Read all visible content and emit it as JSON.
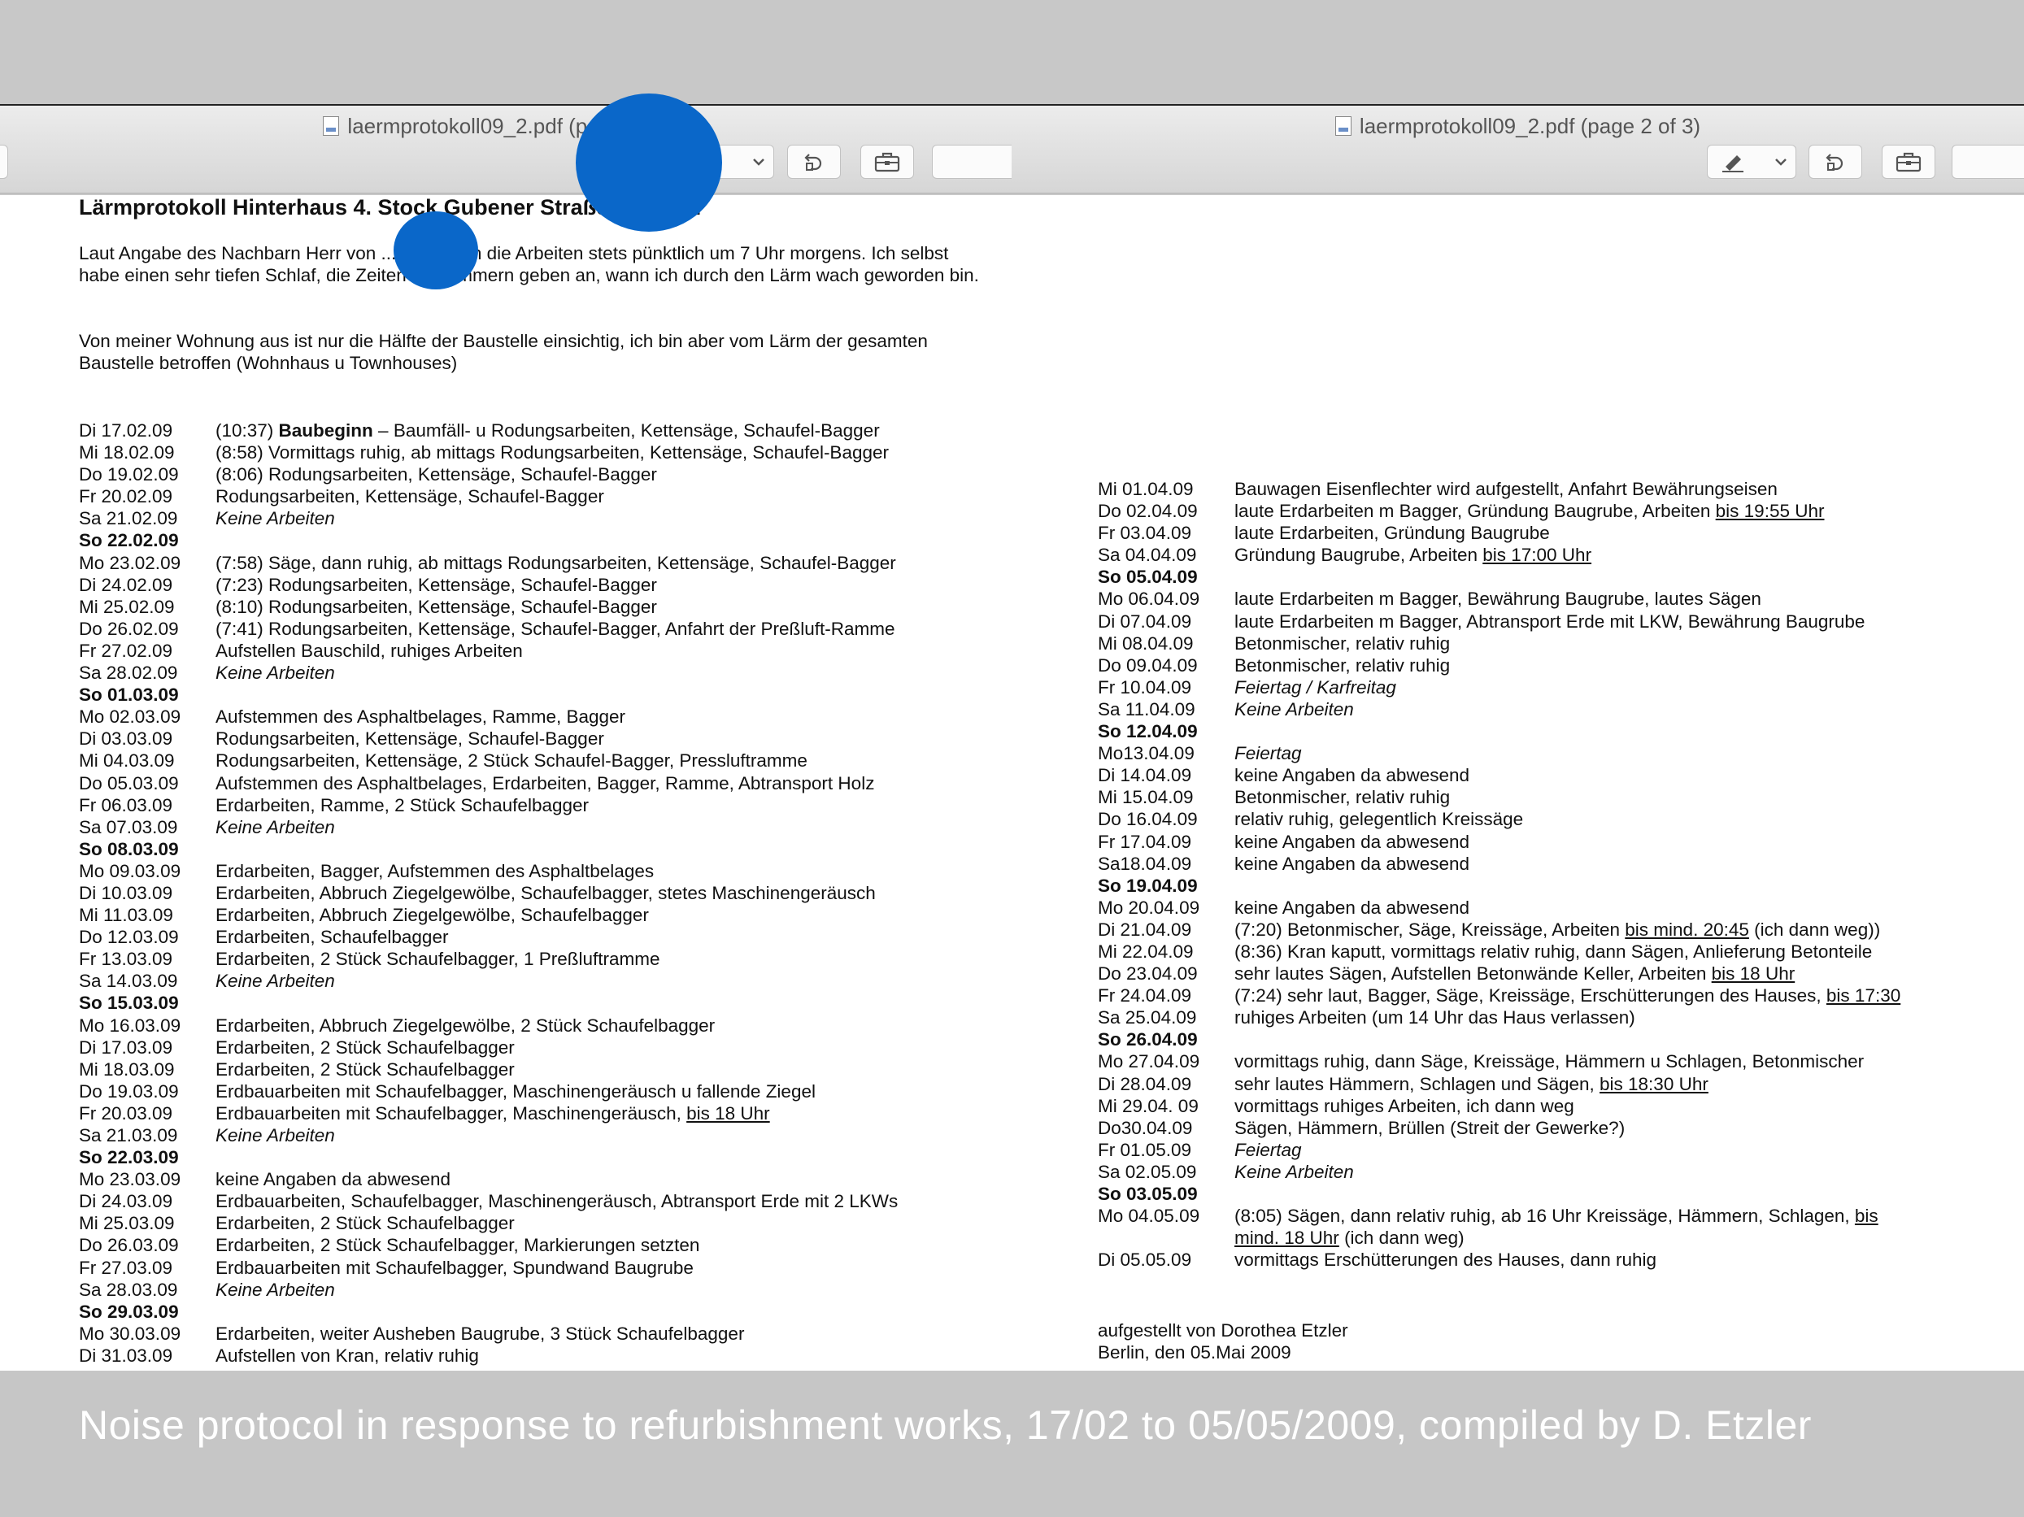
{
  "left_window": {
    "title": "laermprotokoll09_2.pdf (page 1 of 3)"
  },
  "right_window": {
    "title": "laermprotokoll09_2.pdf (page 2 of 3)"
  },
  "toolbar_icons": [
    "annotate-pen-icon",
    "chevron-down-icon",
    "rotate-left-icon",
    "toolbox-icon"
  ],
  "page1": {
    "title": "Lärmprotokoll Hinterhaus 4. Stock Gubener Straße ... Berlin",
    "para1": "Laut Angabe des Nachbarn Herr von ..., beginnen die Arbeiten stets pünktlich um 7 Uhr morgens. Ich selbst habe einen sehr tiefen Schlaf, die Zeiten in Klammern geben an, wann ich durch den Lärm wach geworden bin.",
    "para2": "Von meiner Wohnung aus ist nur die Hälfte der Baustelle einsichtig, ich bin aber vom Lärm der gesamten Baustelle betroffen (Wohnhaus u Townhouses)",
    "entries": [
      {
        "date": "Di 17.02.09",
        "pre": "(10:37) ",
        "bold": "Baubeginn",
        "text": " – Baumfäll- u Rodungsarbeiten, Kettensäge, Schaufel-Bagger"
      },
      {
        "date": "Mi 18.02.09",
        "text": "(8:58) Vormittags ruhig, ab mittags Rodungsarbeiten, Kettensäge, Schaufel-Bagger"
      },
      {
        "date": "Do 19.02.09",
        "text": "(8:06) Rodungsarbeiten, Kettensäge, Schaufel-Bagger"
      },
      {
        "date": "Fr 20.02.09",
        "text": "Rodungsarbeiten, Kettensäge, Schaufel-Bagger"
      },
      {
        "date": "Sa 21.02.09",
        "text": "Keine Arbeiten",
        "italic": true
      },
      {
        "date": "So 22.02.09",
        "sunday": true
      },
      {
        "date": "Mo 23.02.09",
        "text": "(7:58) Säge, dann ruhig, ab mittags Rodungsarbeiten, Kettensäge, Schaufel-Bagger"
      },
      {
        "date": "Di 24.02.09",
        "text": "(7:23) Rodungsarbeiten, Kettensäge, Schaufel-Bagger"
      },
      {
        "date": "Mi 25.02.09",
        "text": "(8:10) Rodungsarbeiten, Kettensäge, Schaufel-Bagger"
      },
      {
        "date": "Do 26.02.09",
        "text": "(7:41) Rodungsarbeiten, Kettensäge, Schaufel-Bagger, Anfahrt der Preßluft-Ramme"
      },
      {
        "date": "Fr 27.02.09",
        "text": "Aufstellen Bauschild, ruhiges Arbeiten"
      },
      {
        "date": "Sa 28.02.09",
        "text": "Keine Arbeiten",
        "italic": true
      },
      {
        "date": "So 01.03.09",
        "sunday": true
      },
      {
        "date": "Mo 02.03.09",
        "text": "Aufstemmen des Asphaltbelages, Ramme, Bagger"
      },
      {
        "date": "Di 03.03.09",
        "text": "Rodungsarbeiten, Kettensäge, Schaufel-Bagger"
      },
      {
        "date": "Mi 04.03.09",
        "text": "Rodungsarbeiten, Kettensäge, 2 Stück Schaufel-Bagger, Pressluftramme"
      },
      {
        "date": "Do 05.03.09",
        "text": "Aufstemmen des Asphaltbelages, Erdarbeiten, Bagger, Ramme, Abtransport Holz"
      },
      {
        "date": "Fr 06.03.09",
        "text": "Erdarbeiten, Ramme, 2 Stück Schaufelbagger"
      },
      {
        "date": "Sa 07.03.09",
        "text": "Keine Arbeiten",
        "italic": true
      },
      {
        "date": "So 08.03.09",
        "sunday": true
      },
      {
        "date": "Mo 09.03.09",
        "text": "Erdarbeiten, Bagger, Aufstemmen des Asphaltbelages"
      },
      {
        "date": "Di 10.03.09",
        "text": "Erdarbeiten, Abbruch Ziegelgewölbe, Schaufelbagger, stetes Maschinengeräusch"
      },
      {
        "date": "Mi 11.03.09",
        "text": "Erdarbeiten, Abbruch Ziegelgewölbe, Schaufelbagger"
      },
      {
        "date": "Do 12.03.09",
        "text": "Erdarbeiten, Schaufelbagger"
      },
      {
        "date": "Fr 13.03.09",
        "text": "Erdarbeiten, 2 Stück Schaufelbagger, 1 Preßluftramme"
      },
      {
        "date": "Sa 14.03.09",
        "text": "Keine Arbeiten",
        "italic": true
      },
      {
        "date": "So 15.03.09",
        "sunday": true
      },
      {
        "date": "Mo 16.03.09",
        "text": "Erdarbeiten, Abbruch Ziegelgewölbe, 2 Stück Schaufelbagger"
      },
      {
        "date": "Di 17.03.09",
        "text": "Erdarbeiten, 2 Stück Schaufelbagger"
      },
      {
        "date": "Mi 18.03.09",
        "text": "Erdarbeiten, 2 Stück Schaufelbagger"
      },
      {
        "date": "Do 19.03.09",
        "text": "Erdbauarbeiten mit Schaufelbagger, Maschinengeräusch u fallende Ziegel"
      },
      {
        "date": "Fr 20.03.09",
        "text": "Erdbauarbeiten mit Schaufelbagger, Maschinengeräusch, ",
        "under": "bis 18 Uhr"
      },
      {
        "date": "Sa 21.03.09",
        "text": "Keine Arbeiten",
        "italic": true
      },
      {
        "date": "So 22.03.09",
        "sunday": true
      },
      {
        "date": "Mo 23.03.09",
        "text": "keine Angaben da abwesend"
      },
      {
        "date": "Di 24.03.09",
        "text": "Erdbauarbeiten, Schaufelbagger, Maschinengeräusch, Abtransport Erde mit 2 LKWs"
      },
      {
        "date": "Mi 25.03.09",
        "text": "Erdarbeiten, 2 Stück Schaufelbagger"
      },
      {
        "date": "Do 26.03.09",
        "text": "Erdarbeiten, 2 Stück Schaufelbagger, Markierungen setzten"
      },
      {
        "date": "Fr 27.03.09",
        "text": "Erdbauarbeiten mit Schaufelbagger, Spundwand Baugrube"
      },
      {
        "date": "Sa 28.03.09",
        "text": "Keine Arbeiten",
        "italic": true
      },
      {
        "date": "So 29.03.09",
        "sunday": true
      },
      {
        "date": "Mo 30.03.09",
        "text": "Erdarbeiten, weiter Ausheben Baugrube, 3 Stück Schaufelbagger"
      },
      {
        "date": "Di 31.03.09",
        "text": "Aufstellen von Kran, relativ ruhig"
      }
    ]
  },
  "page2": {
    "entries": [
      {
        "date": "Mi 01.04.09",
        "text": "Bauwagen Eisenflechter wird aufgestellt, Anfahrt Bewährungseisen"
      },
      {
        "date": "Do 02.04.09",
        "text": "laute Erdarbeiten m Bagger, Gründung Baugrube, Arbeiten ",
        "under": "bis 19:55 Uhr"
      },
      {
        "date": "Fr 03.04.09",
        "text": "laute Erdarbeiten, Gründung Baugrube"
      },
      {
        "date": "Sa 04.04.09",
        "text": "Gründung Baugrube, Arbeiten ",
        "under": "bis 17:00 Uhr"
      },
      {
        "date": "So 05.04.09",
        "sunday": true
      },
      {
        "date": "Mo 06.04.09",
        "text": "laute Erdarbeiten m Bagger, Bewährung Baugrube, lautes Sägen"
      },
      {
        "date": "Di 07.04.09",
        "text": "laute Erdarbeiten m Bagger, Abtransport Erde mit LKW, Bewährung Baugrube"
      },
      {
        "date": "Mi 08.04.09",
        "text": "Betonmischer, relativ ruhig"
      },
      {
        "date": "Do 09.04.09",
        "text": "Betonmischer, relativ ruhig"
      },
      {
        "date": "Fr 10.04.09",
        "text": "Feiertag / Karfreitag",
        "italic": true
      },
      {
        "date": "Sa 11.04.09",
        "text": "Keine Arbeiten",
        "italic": true
      },
      {
        "date": "So 12.04.09",
        "sunday": true
      },
      {
        "date": "Mo13.04.09",
        "text": "Feiertag",
        "italic": true
      },
      {
        "date": "Di 14.04.09",
        "text": "keine Angaben da abwesend"
      },
      {
        "date": "Mi 15.04.09",
        "text": "Betonmischer, relativ ruhig"
      },
      {
        "date": "Do 16.04.09",
        "text": "relativ ruhig, gelegentlich Kreissäge"
      },
      {
        "date": "Fr 17.04.09",
        "text": "keine Angaben da abwesend"
      },
      {
        "date": "Sa18.04.09",
        "text": "keine Angaben da abwesend"
      },
      {
        "date": "So 19.04.09",
        "sunday": true
      },
      {
        "date": "Mo 20.04.09",
        "text": "keine Angaben da abwesend"
      },
      {
        "date": "Di 21.04.09",
        "text": "(7:20)   Betonmischer, Säge, Kreissäge, Arbeiten ",
        "under": "bis mind. 20:45",
        "post": " (ich dann weg))"
      },
      {
        "date": "Mi 22.04.09",
        "text": "(8:36)   Kran kaputt, vormittags relativ ruhig, dann Sägen, Anlieferung Betonteile"
      },
      {
        "date": "Do 23.04.09",
        "text": "sehr lautes Sägen, Aufstellen Betonwände Keller, Arbeiten ",
        "under": "bis 18 Uhr"
      },
      {
        "date": "Fr 24.04.09",
        "text": "(7:24)   sehr laut, Bagger, Säge, Kreissäge, Erschütterungen des Hauses, ",
        "under": "bis 17:30"
      },
      {
        "date": "Sa 25.04.09",
        "text": "ruhiges Arbeiten (um 14 Uhr das Haus verlassen)"
      },
      {
        "date": "So 26.04.09",
        "sunday": true
      },
      {
        "date": "Mo 27.04.09",
        "text": "vormittags ruhig, dann Säge, Kreissäge, Hämmern u Schlagen, Betonmischer"
      },
      {
        "date": "Di 28.04.09",
        "text": "sehr lautes Hämmern, Schlagen und Sägen, ",
        "under": "bis 18:30 Uhr"
      },
      {
        "date": "Mi 29.04. 09",
        "text": "vormittags ruhiges Arbeiten, ich dann weg"
      },
      {
        "date": "Do30.04.09",
        "text": "Sägen, Hämmern, Brüllen (Streit der Gewerke?)"
      },
      {
        "date": "Fr 01.05.09",
        "text": "Feiertag",
        "italic": true
      },
      {
        "date": "Sa 02.05.09",
        "text": "Keine Arbeiten",
        "italic": true
      },
      {
        "date": "So 03.05.09",
        "sunday": true
      },
      {
        "date": "Mo 04.05.09",
        "text": "(8:05)   Sägen, dann relativ ruhig, ab 16 Uhr Kreissäge, Hämmern, Schlagen, ",
        "under": "bis "
      },
      {
        "date": "",
        "text": "",
        "under": "mind. 18 Uhr",
        "post": " (ich dann weg)"
      },
      {
        "date": "Di 05.05.09",
        "text": "vormittags Erschütterungen des Hauses, dann ruhig"
      }
    ],
    "signature_line1": "aufgestellt von Dorothea Etzler",
    "signature_line2": "Berlin, den 05.Mai 2009"
  },
  "caption": "Noise protocol in response to refurbishment works, 17/02 to 05/05/2009, compiled by D. Etzler",
  "colors": {
    "redaction": "#0a67c9",
    "background": "#c8c8c8"
  }
}
